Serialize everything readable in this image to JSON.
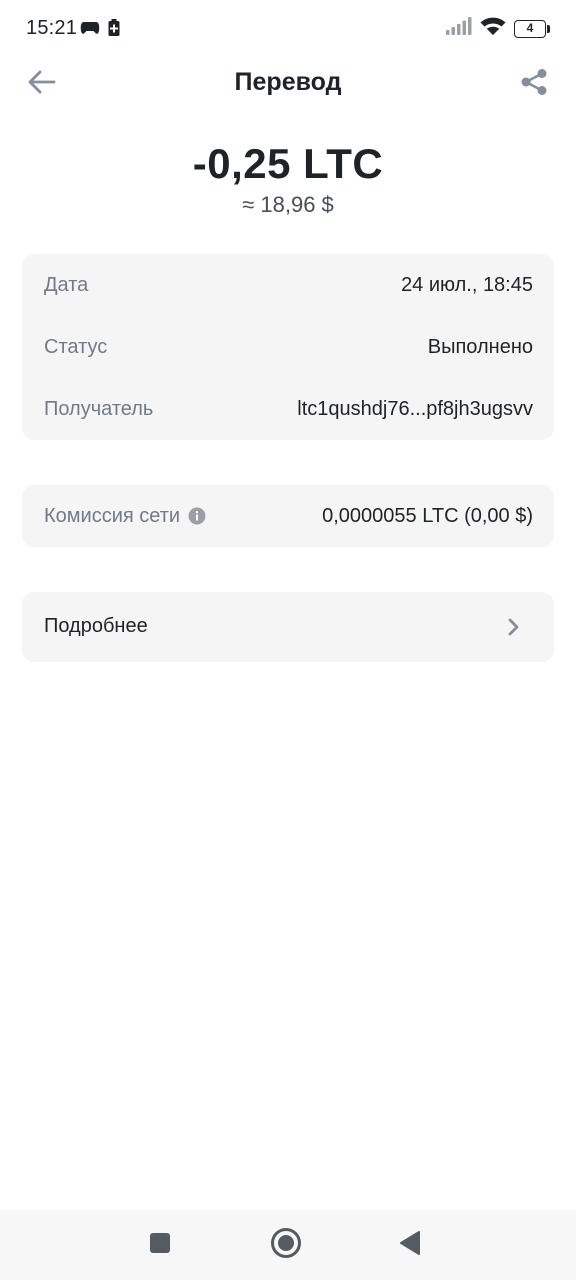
{
  "status_bar": {
    "time": "15:21",
    "battery_level": "4",
    "icons": [
      "gamepad-icon",
      "battery-saver-icon",
      "signal-icon",
      "wifi-icon",
      "battery-icon"
    ]
  },
  "header": {
    "title": "Перевод",
    "back_icon": "arrow-left-icon",
    "share_icon": "share-icon"
  },
  "transaction": {
    "amount": "-0,25 LTC",
    "fiat_amount": "≈ 18,96 $"
  },
  "details": {
    "date_label": "Дата",
    "date_value": "24 июл., 18:45",
    "status_label": "Статус",
    "status_value": "Выполнено",
    "recipient_label": "Получатель",
    "recipient_value": "ltc1qushdj76...pf8jh3ugsvv"
  },
  "fee": {
    "label": "Комиссия сети",
    "info_icon": "info-icon",
    "value": "0,0000055 LTC (0,00 $)"
  },
  "more": {
    "label": "Подробнее",
    "chevron_icon": "chevron-right-icon"
  },
  "nav_bar": {
    "icons": [
      "recents-square-icon",
      "home-circle-icon",
      "back-triangle-icon"
    ]
  },
  "colors": {
    "text_primary": "#1e2329",
    "text_secondary": "#707a8a",
    "card_background": "#f5f5f5",
    "icon_gray": "#848e9c"
  }
}
